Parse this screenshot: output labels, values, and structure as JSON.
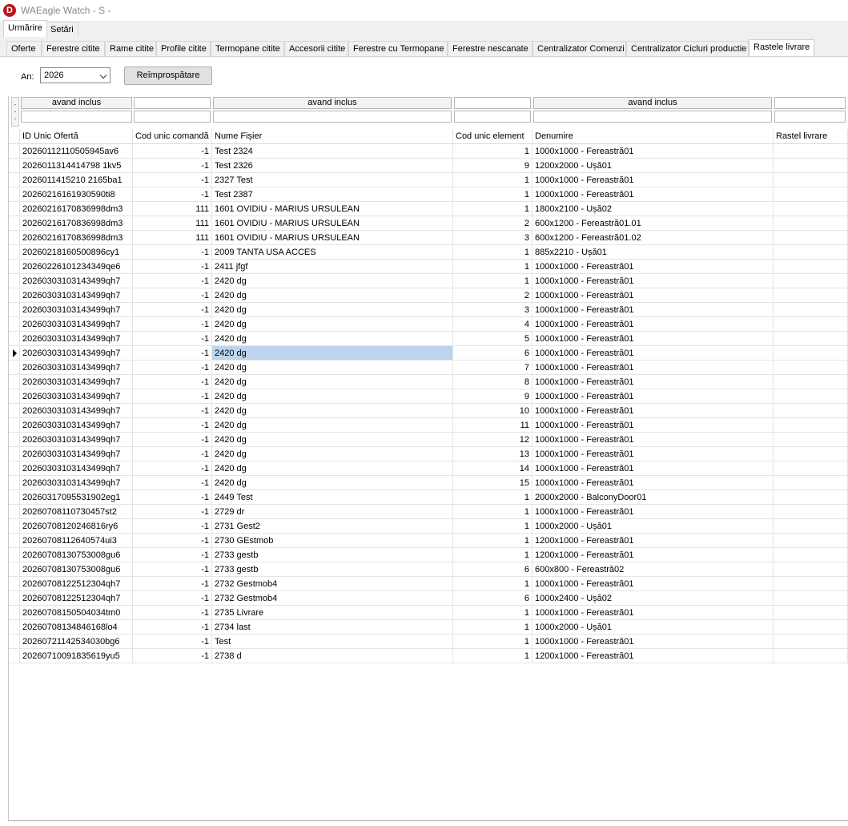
{
  "app": {
    "logo_letter": "D",
    "title": "WAEagle Watch - S -"
  },
  "top_tabs": [
    {
      "label": "Urmărire",
      "active": true
    },
    {
      "label": "Setări",
      "active": false
    }
  ],
  "sub_tabs": [
    {
      "label": "Oferte"
    },
    {
      "label": "Ferestre citite"
    },
    {
      "label": "Rame citite"
    },
    {
      "label": "Profile citite"
    },
    {
      "label": "Termopane citite"
    },
    {
      "label": "Accesorii citite"
    },
    {
      "label": "Ferestre cu Termopane"
    },
    {
      "label": "Ferestre nescanate"
    },
    {
      "label": "Centralizator Comenzi"
    },
    {
      "label": "Centralizator Cicluri productie"
    },
    {
      "label": "Rastele livrare",
      "active": true
    }
  ],
  "toolbar": {
    "year_label": "An:",
    "year_value": "2026",
    "refresh_label": "Reîmprospătare"
  },
  "filters": {
    "f1": "avand inclus",
    "f3": "avand inclus",
    "f5": "avand inclus"
  },
  "columns": [
    "ID Unic Ofertă",
    "Cod unic comandă",
    "Nume Fișier",
    "Cod unic element",
    "Denumire",
    "Rastel livrare"
  ],
  "selected_row": 14,
  "rows": [
    [
      "20260112110505945av6",
      "-1",
      "Test 2324",
      "1",
      "1000x1000 - Fereastră01",
      ""
    ],
    [
      "2026011314414798 1kv5",
      "-1",
      "Test 2326",
      "9",
      "1200x2000 - Ușă01",
      ""
    ],
    [
      "2026011415210 2165ba1",
      "-1",
      "2327 Test",
      "1",
      "1000x1000 - Fereastră01",
      ""
    ],
    [
      "20260216161930590ti8",
      "-1",
      "Test 2387",
      "1",
      "1000x1000 - Fereastră01",
      ""
    ],
    [
      "20260216170836998dm3",
      "111",
      "1601 OVIDIU - MARIUS URSULEAN",
      "1",
      "1800x2100 - Ușă02",
      ""
    ],
    [
      "20260216170836998dm3",
      "111",
      "1601 OVIDIU - MARIUS URSULEAN",
      "2",
      "600x1200 - Fereastră01.01",
      ""
    ],
    [
      "20260216170836998dm3",
      "111",
      "1601 OVIDIU - MARIUS URSULEAN",
      "3",
      "600x1200 - Fereastră01.02",
      ""
    ],
    [
      "20260218160500896cy1",
      "-1",
      "2009 TANTA USA ACCES",
      "1",
      "885x2210 - Ușă01",
      ""
    ],
    [
      "20260226101234349qe6",
      "-1",
      "2411 jfgf",
      "1",
      "1000x1000 - Fereastră01",
      ""
    ],
    [
      "20260303103143499qh7",
      "-1",
      "2420 dg",
      "1",
      "1000x1000 - Fereastră01",
      ""
    ],
    [
      "20260303103143499qh7",
      "-1",
      "2420 dg",
      "2",
      "1000x1000 - Fereastră01",
      ""
    ],
    [
      "20260303103143499qh7",
      "-1",
      "2420 dg",
      "3",
      "1000x1000 - Fereastră01",
      ""
    ],
    [
      "20260303103143499qh7",
      "-1",
      "2420 dg",
      "4",
      "1000x1000 - Fereastră01",
      ""
    ],
    [
      "20260303103143499qh7",
      "-1",
      "2420 dg",
      "5",
      "1000x1000 - Fereastră01",
      ""
    ],
    [
      "20260303103143499qh7",
      "-1",
      "2420 dg",
      "6",
      "1000x1000 - Fereastră01",
      ""
    ],
    [
      "20260303103143499qh7",
      "-1",
      "2420 dg",
      "7",
      "1000x1000 - Fereastră01",
      ""
    ],
    [
      "20260303103143499qh7",
      "-1",
      "2420 dg",
      "8",
      "1000x1000 - Fereastră01",
      ""
    ],
    [
      "20260303103143499qh7",
      "-1",
      "2420 dg",
      "9",
      "1000x1000 - Fereastră01",
      ""
    ],
    [
      "20260303103143499qh7",
      "-1",
      "2420 dg",
      "10",
      "1000x1000 - Fereastră01",
      ""
    ],
    [
      "20260303103143499qh7",
      "-1",
      "2420 dg",
      "11",
      "1000x1000 - Fereastră01",
      ""
    ],
    [
      "20260303103143499qh7",
      "-1",
      "2420 dg",
      "12",
      "1000x1000 - Fereastră01",
      ""
    ],
    [
      "20260303103143499qh7",
      "-1",
      "2420 dg",
      "13",
      "1000x1000 - Fereastră01",
      ""
    ],
    [
      "20260303103143499qh7",
      "-1",
      "2420 dg",
      "14",
      "1000x1000 - Fereastră01",
      ""
    ],
    [
      "20260303103143499qh7",
      "-1",
      "2420 dg",
      "15",
      "1000x1000 - Fereastră01",
      ""
    ],
    [
      "20260317095531902eg1",
      "-1",
      "2449 Test",
      "1",
      "2000x2000 - BalconyDoor01",
      ""
    ],
    [
      "20260708110730457st2",
      "-1",
      "2729 dr",
      "1",
      "1000x1000 - Fereastră01",
      ""
    ],
    [
      "20260708120246816ry6",
      "-1",
      "2731 Gest2",
      "1",
      "1000x2000 - Ușă01",
      ""
    ],
    [
      "20260708112640574ui3",
      "-1",
      "2730 GEstmob",
      "1",
      "1200x1000 - Fereastră01",
      ""
    ],
    [
      "20260708130753008gu6",
      "-1",
      "2733 gestb",
      "1",
      "1200x1000 - Fereastră01",
      ""
    ],
    [
      "20260708130753008gu6",
      "-1",
      "2733 gestb",
      "6",
      "600x800 - Fereastră02",
      ""
    ],
    [
      "20260708122512304qh7",
      "-1",
      "2732 Gestmob4",
      "1",
      "1000x1000 - Fereastră01",
      ""
    ],
    [
      "20260708122512304qh7",
      "-1",
      "2732 Gestmob4",
      "6",
      "1000x2400 - Ușă02",
      ""
    ],
    [
      "20260708150504034tm0",
      "-1",
      "2735 Livrare",
      "1",
      "1000x1000 - Fereastră01",
      ""
    ],
    [
      "20260708134846168lo4",
      "-1",
      "2734 last",
      "1",
      "1000x2000 - Ușă01",
      ""
    ],
    [
      "20260721142534030bg6",
      "-1",
      "Test",
      "1",
      "1000x1000 - Fereastră01",
      ""
    ],
    [
      "20260710091835619yu5",
      "-1",
      "2738 d",
      "1",
      "1200x1000 - Fereastră01",
      ""
    ]
  ],
  "colors": {
    "selection": "#bcd4ec",
    "logo": "#c0151b"
  }
}
